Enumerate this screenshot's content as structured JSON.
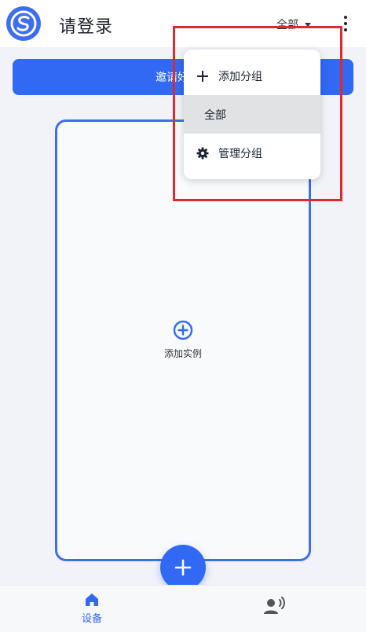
{
  "header": {
    "title": "请登录",
    "group_selected": "全部"
  },
  "banner": {
    "text": "邀请好友免"
  },
  "card": {
    "add_instance_label": "添加实例"
  },
  "menu": {
    "add_group": "添加分组",
    "all": "全部",
    "manage_group": "管理分组"
  },
  "bottom_nav": {
    "devices_label": "设备"
  },
  "colors": {
    "accent": "#3169f5",
    "highlight": "#e0292c",
    "selected_item_bg": "#e1e2e4"
  },
  "icons": [
    "app-logo-icon",
    "caret-down-icon",
    "more-vert-icon",
    "plus-circle-icon",
    "plus-icon",
    "add-icon",
    "gear-icon",
    "home-icon",
    "voice-person-icon"
  ]
}
